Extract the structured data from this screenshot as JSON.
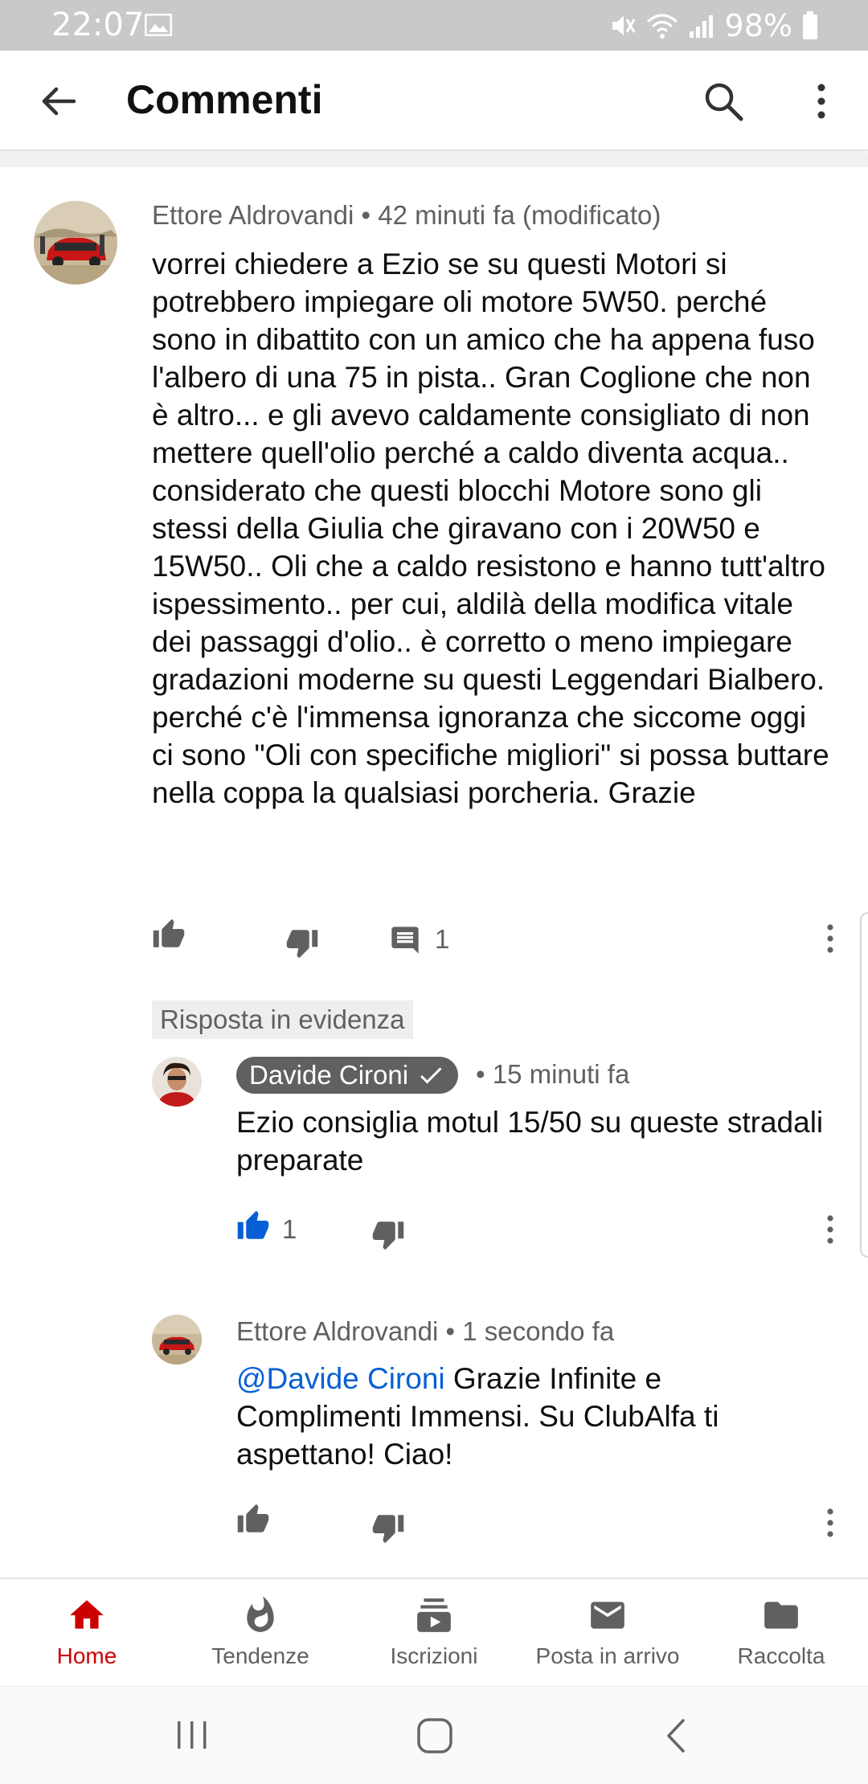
{
  "status_bar": {
    "time": "22:07",
    "battery": "98%"
  },
  "app_bar": {
    "title": "Commenti"
  },
  "comments": [
    {
      "author": "Ettore Aldrovandi",
      "meta": "• 42 minuti fa (modificato)",
      "text": "vorrei chiedere a Ezio se su questi Motori si potrebbero impiegare oli motore 5W50. perché sono in dibattito con un amico che ha appena fuso l'albero di una 75 in pista.. Gran Coglione che non è altro... e gli avevo caldamente consigliato di non mettere quell'olio perché a caldo diventa acqua.. considerato che questi blocchi Motore sono gli stessi della Giulia che giravano con i 20W50 e 15W50.. Oli che a caldo resistono e hanno tutt'altro ispessimento.. per cui, aldilà della modifica vitale dei passaggi d'olio.. è corretto o meno impiegare gradazioni moderne su questi Leggendari Bialbero. perché c'è l'immensa ignoranza che siccome oggi ci sono \"Oli con specifiche migliori\" si possa buttare nella coppa la qualsiasi porcheria. Grazie",
      "reply_count": "1"
    }
  ],
  "replies_section": {
    "highlight_label": "Risposta in evidenza",
    "replies": [
      {
        "author": "Davide Cironi",
        "meta": "• 15 minuti fa",
        "text": "Ezio consiglia motul 15/50 su queste stradali preparate",
        "like_count": "1",
        "liked": true
      },
      {
        "author": "Ettore Aldrovandi",
        "meta": "• 1 secondo fa",
        "mention": "@Davide Cironi",
        "text": " Grazie Infinite e Complimenti Immensi. Su ClubAlfa ti aspettano! Ciao!"
      }
    ]
  },
  "bottom_nav": [
    {
      "label": "Home",
      "icon": "home-icon",
      "active": true
    },
    {
      "label": "Tendenze",
      "icon": "flame-icon"
    },
    {
      "label": "Iscrizioni",
      "icon": "subscriptions-icon"
    },
    {
      "label": "Posta in arrivo",
      "icon": "mail-icon"
    },
    {
      "label": "Raccolta",
      "icon": "folder-icon"
    }
  ],
  "colors": {
    "accent_red": "#cc0000",
    "link_blue": "#065fd4",
    "like_blue": "#065fd4",
    "text_secondary": "#606060"
  }
}
